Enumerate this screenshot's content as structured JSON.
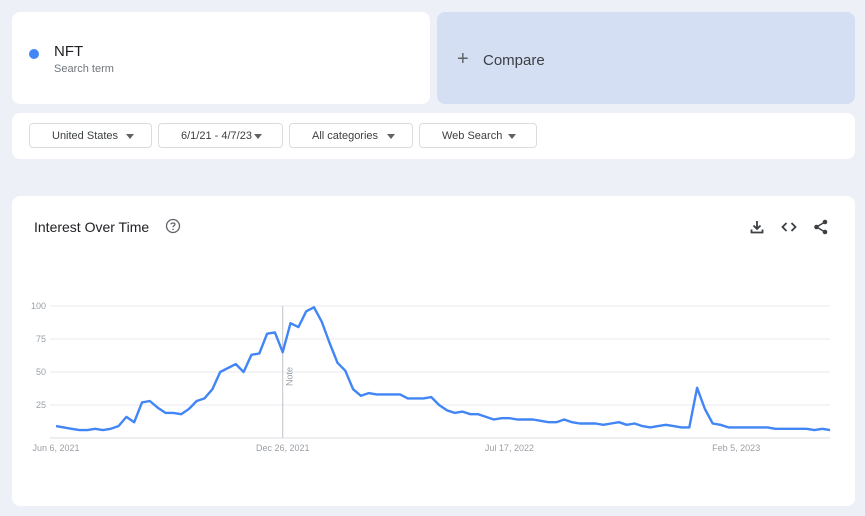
{
  "search_term": {
    "name": "NFT",
    "subtitle": "Search term",
    "color": "#4285f4"
  },
  "compare": {
    "label": "Compare",
    "icon": "plus-icon"
  },
  "filters": [
    {
      "label": "United States"
    },
    {
      "label": "6/1/21 - 4/7/23"
    },
    {
      "label": "All categories"
    },
    {
      "label": "Web Search"
    }
  ],
  "chart_panel": {
    "title": "Interest Over Time",
    "help_icon": "help-circle-icon",
    "tools": [
      "download-icon",
      "embed-code-icon",
      "share-icon"
    ]
  },
  "chart_data": {
    "type": "line",
    "title": "Interest Over Time",
    "xlabel": "",
    "ylabel": "",
    "ylim": [
      0,
      100
    ],
    "y_ticks": [
      "100",
      "75",
      "50",
      "25"
    ],
    "x_ticks": [
      "Jun 6, 2021",
      "Dec 26, 2021",
      "Jul 17, 2022",
      "Feb 5, 2023"
    ],
    "note": {
      "label": "Note",
      "week_index": 29
    },
    "grid": true,
    "series": [
      {
        "name": "NFT",
        "color": "#4285f4",
        "values": [
          9,
          8,
          7,
          6,
          6,
          7,
          6,
          7,
          9,
          16,
          12,
          27,
          28,
          23,
          19,
          19,
          18,
          22,
          28,
          30,
          37,
          50,
          53,
          56,
          50,
          63,
          64,
          79,
          80,
          65,
          87,
          84,
          96,
          99,
          88,
          72,
          57,
          51,
          37,
          32,
          34,
          33,
          33,
          33,
          33,
          30,
          30,
          30,
          31,
          25,
          21,
          19,
          20,
          18,
          18,
          16,
          14,
          15,
          15,
          14,
          14,
          14,
          13,
          12,
          12,
          14,
          12,
          11,
          11,
          11,
          10,
          11,
          12,
          10,
          11,
          9,
          8,
          9,
          10,
          9,
          8,
          8,
          38,
          22,
          11,
          10,
          8,
          8,
          8,
          8,
          8,
          8,
          7,
          7,
          7,
          7,
          7,
          6,
          7,
          6
        ]
      }
    ]
  }
}
